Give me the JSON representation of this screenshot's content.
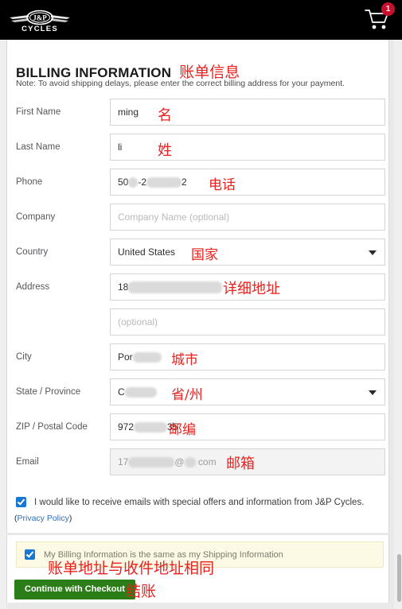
{
  "header": {
    "logo_text_top": "J&P",
    "logo_text_bottom": "CYCLES",
    "cart_count": "1"
  },
  "billing": {
    "title": "BILLING INFORMATION",
    "title_annotation": "账单信息",
    "note": "Note: To avoid shipping delays, please enter the correct billing address for your payment.",
    "fields": [
      {
        "label": "First Name",
        "value": "ming",
        "annotation": "名",
        "type": "text"
      },
      {
        "label": "Last Name",
        "value": "li",
        "annotation": "姓",
        "type": "text"
      },
      {
        "label": "Phone",
        "value": "50",
        "value_tail": "2",
        "annotation": "电话",
        "type": "text-redacted"
      },
      {
        "label": "Company",
        "placeholder": "Company Name (optional)",
        "annotation": "",
        "type": "text"
      },
      {
        "label": "Country",
        "value": "United States",
        "annotation": "国家",
        "type": "select"
      },
      {
        "label": "Address",
        "value": "18",
        "annotation": "详细地址",
        "type": "text-redacted"
      },
      {
        "label": "",
        "placeholder": "(optional)",
        "annotation": "",
        "type": "text"
      },
      {
        "label": "City",
        "value": "Por",
        "annotation": "城市",
        "type": "text-redacted"
      },
      {
        "label": "State / Province",
        "value": "C",
        "annotation": "省/州",
        "type": "select-redacted"
      },
      {
        "label": "ZIP / Postal Code",
        "value": "972",
        "value_tail": "35",
        "annotation": "邮编",
        "type": "text-redacted"
      },
      {
        "label": "Email",
        "value": "17",
        "value_tail": "com",
        "annotation": "邮箱",
        "type": "email-disabled"
      }
    ],
    "phone_tail": "2",
    "zip_tail": "35",
    "email_at": "@",
    "email_tail": "com",
    "consent_label": "I would like to receive emails with special offers and information from J&P Cycles.",
    "privacy_open": "(",
    "privacy_link": "Privacy Policy",
    "privacy_close": ")"
  },
  "bottom": {
    "same_as_shipping_label": "My Billing Information is the same as my Shipping Information",
    "same_as_shipping_annotation": "账单地址与收件地址相同",
    "checkout_label": "Continue with Checkout",
    "checkout_annotation": "结账"
  },
  "colors": {
    "header_bg": "#000000",
    "badge": "#c8102e",
    "annotation_red": "#e8221e",
    "checkbox_blue": "#1877d2",
    "button_green": "#2b7d18",
    "banner_yellow": "#fcfae4"
  }
}
